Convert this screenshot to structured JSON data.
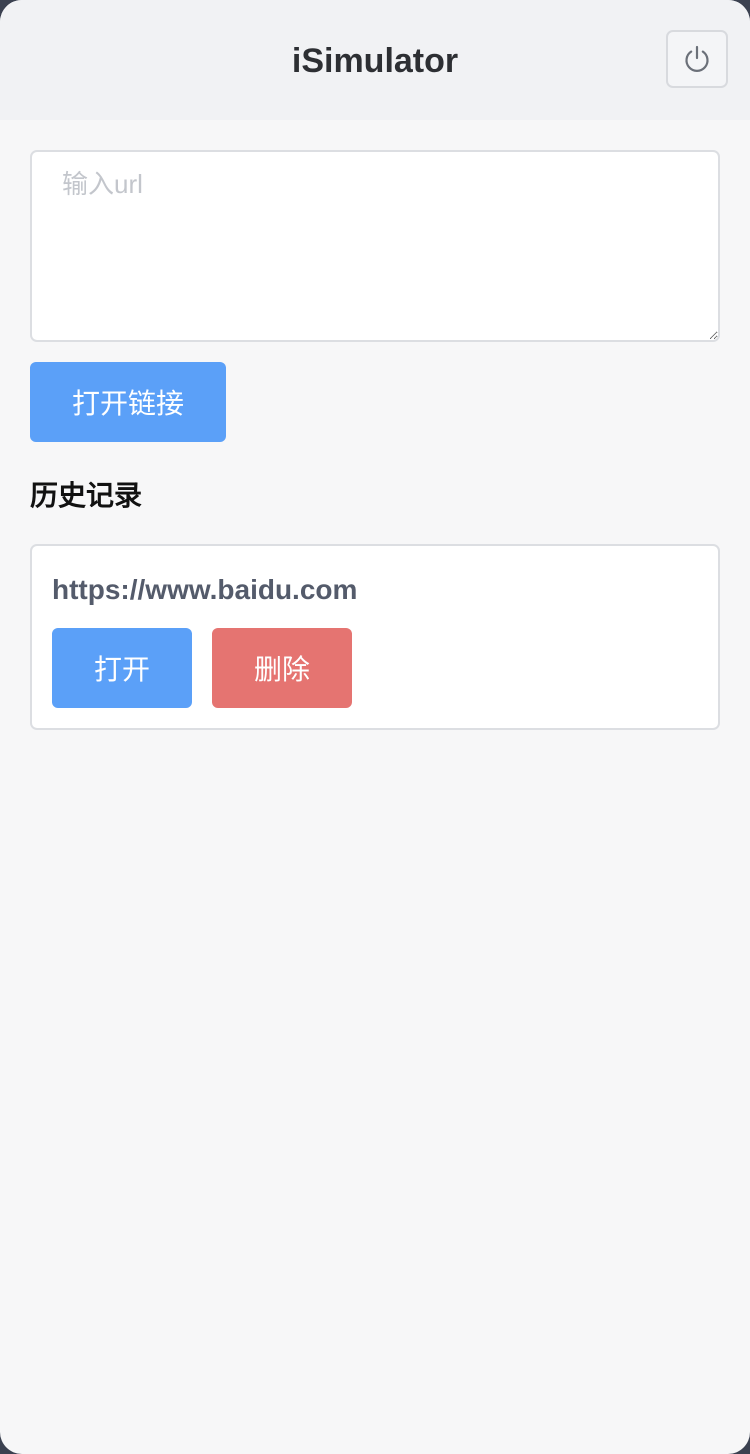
{
  "header": {
    "title": "iSimulator",
    "power_icon": "power-icon"
  },
  "url_input": {
    "value": "",
    "placeholder": "输入url"
  },
  "open_link_button": {
    "label": "打开链接"
  },
  "history": {
    "title": "历史记录",
    "items": [
      {
        "url": "https://www.baidu.com",
        "open_label": "打开",
        "delete_label": "删除"
      }
    ]
  },
  "colors": {
    "primary": "#5ba0f8",
    "danger": "#e57471",
    "header_bg": "#f1f2f4",
    "page_bg": "#f7f7f8"
  }
}
